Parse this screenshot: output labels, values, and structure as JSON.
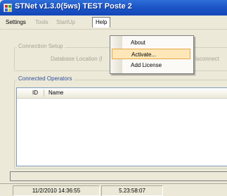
{
  "window": {
    "title": "STNet v1.3.0(5ws) TEST Poste 2"
  },
  "menu": {
    "settings": "Settings",
    "tools": "Tools",
    "startup": "StartUp",
    "help": "Help",
    "help_items": [
      "About",
      "Activate...",
      "Add License"
    ]
  },
  "connection_setup": {
    "title": "Connection Setup",
    "database_location": "Database Location (l",
    "disconnect": "isconnect"
  },
  "operators": {
    "title": "Connected Operators",
    "columns": [
      "ID",
      "Name"
    ],
    "rows": []
  },
  "status": {
    "datetime": "11/2/2010 14:36:55",
    "uptime": "5.23:58:07"
  }
}
